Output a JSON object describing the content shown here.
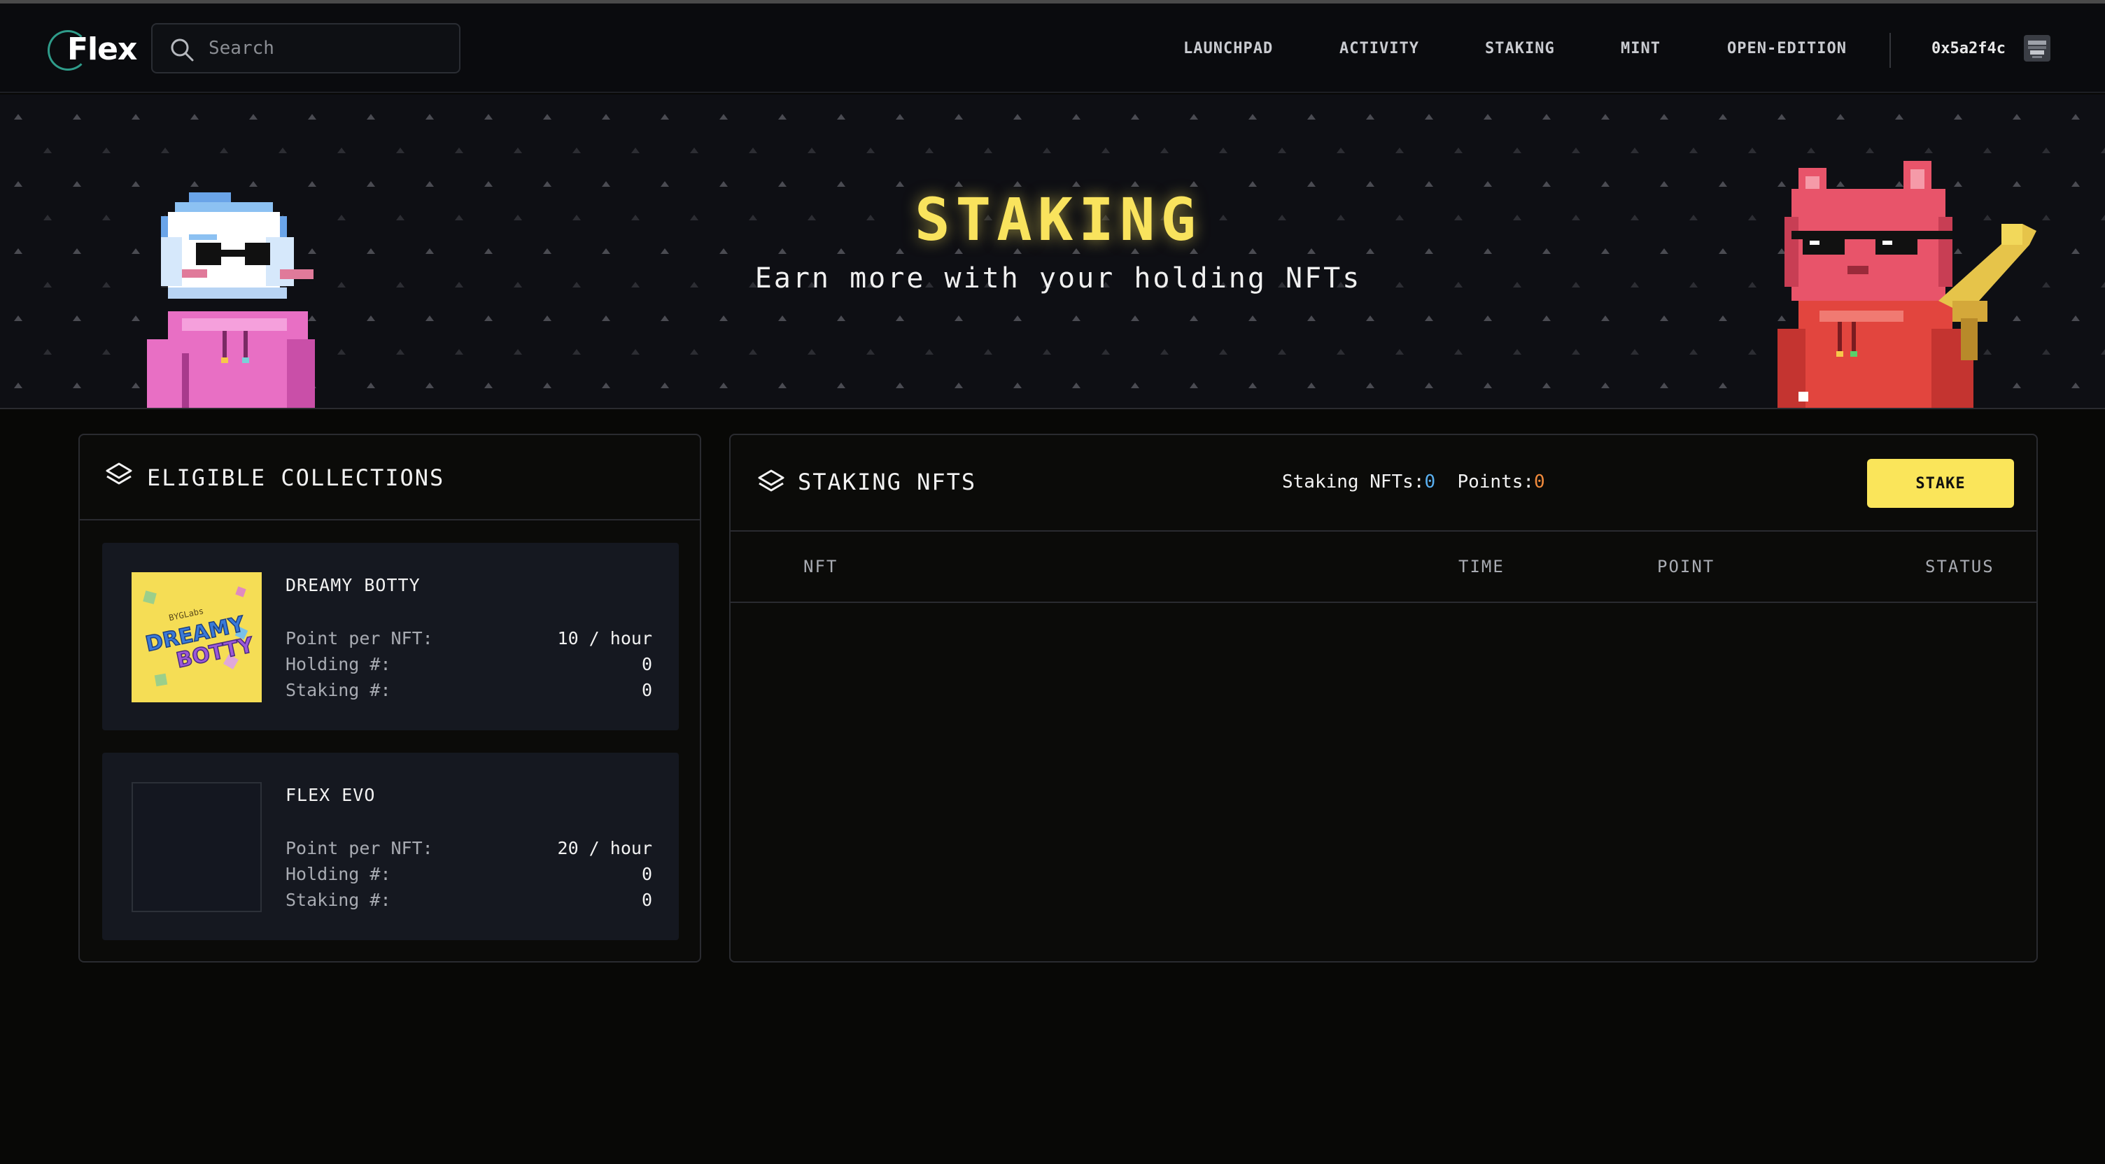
{
  "header": {
    "logo_text": "Flex",
    "search_placeholder": "Search",
    "nav": [
      "LAUNCHPAD",
      "ACTIVITY",
      "STAKING",
      "MINT",
      "OPEN-EDITION"
    ],
    "wallet_address": "0x5a2f4c"
  },
  "hero": {
    "title": "STAKING",
    "subtitle": "Earn more with your holding NFTs"
  },
  "eligible": {
    "title": "ELIGIBLE COLLECTIONS",
    "collections": [
      {
        "name": "DREAMY BOTTY",
        "thumb_text_top": "BYGLabs",
        "thumb_text_1": "DREAMY",
        "thumb_text_2": "BOTTY",
        "point_label": "Point per NFT:",
        "point_value": "10 / hour",
        "holding_label": "Holding #:",
        "holding_value": "0",
        "staking_label": "Staking #:",
        "staking_value": "0"
      },
      {
        "name": "FLEX EVO",
        "point_label": "Point per NFT:",
        "point_value": "20 / hour",
        "holding_label": "Holding #:",
        "holding_value": "0",
        "staking_label": "Staking #:",
        "staking_value": "0"
      }
    ]
  },
  "staking": {
    "title": "STAKING NFTS",
    "nfts_label": "Staking NFTs:",
    "nfts_value": "0",
    "points_label": "Points:",
    "points_value": "0",
    "stake_button": "STAKE",
    "columns": [
      "NFT",
      "TIME",
      "POINT",
      "STATUS"
    ]
  },
  "colors": {
    "accent_yellow": "#fae55a",
    "background": "#080806",
    "card": "#151820",
    "count_blue": "#5ab0f0",
    "count_orange": "#f08a3c"
  },
  "icons": [
    "search-icon",
    "layers-icon",
    "wallet-avatar-icon"
  ]
}
